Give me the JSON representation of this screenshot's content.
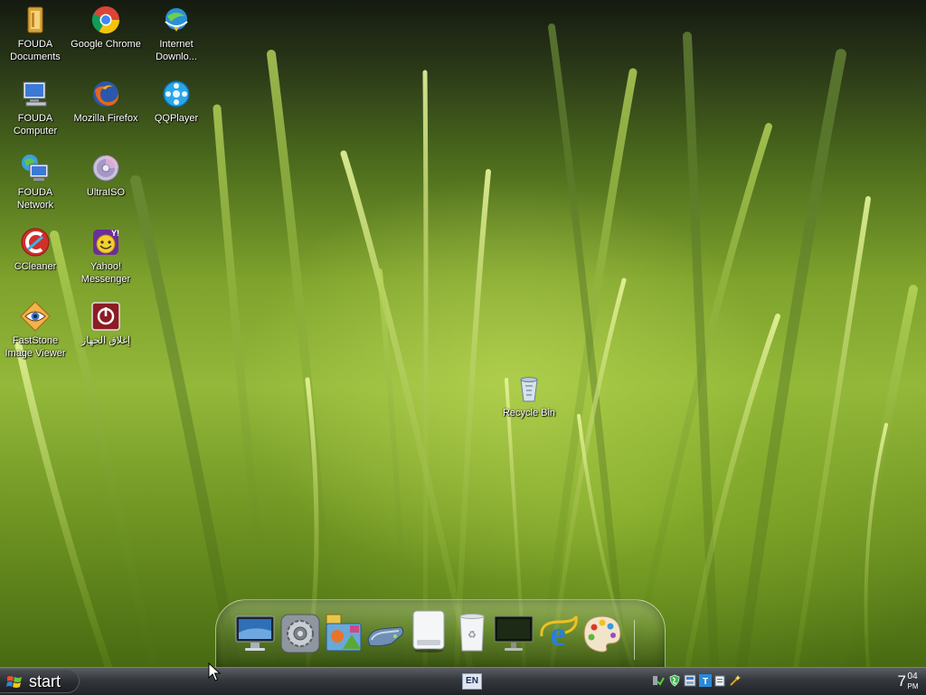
{
  "desktop": {
    "icons": [
      {
        "label": "FOUDA\nDocuments"
      },
      {
        "label": "Google Chrome"
      },
      {
        "label": "Internet\nDownlo..."
      },
      {
        "label": "FOUDA\nComputer"
      },
      {
        "label": "Mozilla Firefox"
      },
      {
        "label": "QQPlayer"
      },
      {
        "label": "FOUDA\nNetwork"
      },
      {
        "label": "UltraISO"
      },
      {
        "label": "CCleaner"
      },
      {
        "label": "Yahoo!\nMessenger"
      },
      {
        "label": "FastStone\nImage Viewer"
      },
      {
        "label": "إغلاق الجهاز"
      },
      {
        "label": "Recycle Bin"
      }
    ]
  },
  "dock": {
    "items": [
      {
        "icon": "monitor-icon"
      },
      {
        "icon": "system-preferences-icon"
      },
      {
        "icon": "photo-gallery-icon"
      },
      {
        "icon": "drive-icon"
      },
      {
        "icon": "removable-disk-icon"
      },
      {
        "icon": "trash-icon"
      },
      {
        "icon": "display-icon"
      },
      {
        "icon": "internet-explorer-icon"
      },
      {
        "icon": "paint-palette-icon"
      }
    ]
  },
  "taskbar": {
    "start_label": "start",
    "language": "EN",
    "clock": {
      "hour": "7",
      "minute": "04",
      "ampm": "PM"
    }
  }
}
